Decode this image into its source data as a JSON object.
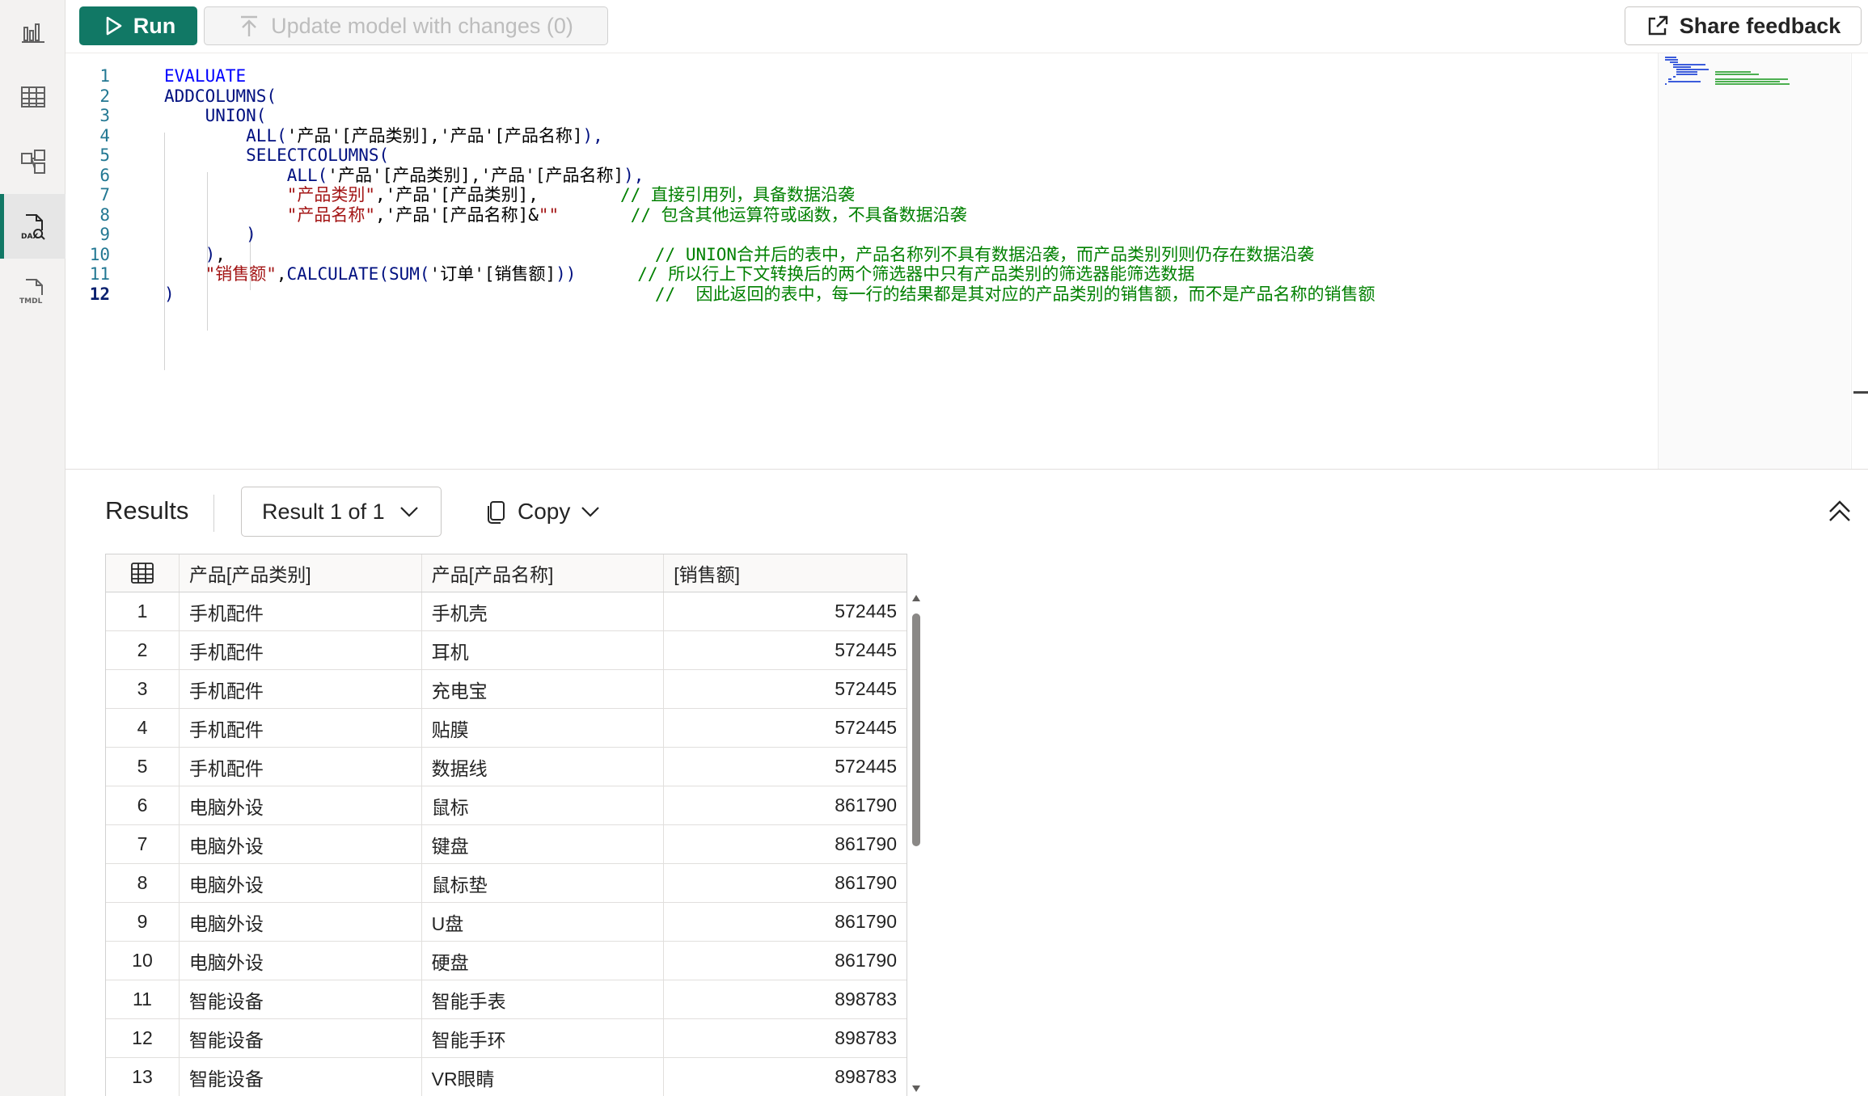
{
  "toolbar": {
    "run_label": "Run",
    "update_label": "Update model with changes (0)",
    "share_label": "Share feedback"
  },
  "sidebar": {
    "items": [
      {
        "icon": "report-icon"
      },
      {
        "icon": "table-icon"
      },
      {
        "icon": "model-icon"
      },
      {
        "icon": "dax-query-icon",
        "label": "DAX",
        "active": true
      },
      {
        "icon": "tmdl-icon",
        "label": "TMDL"
      }
    ]
  },
  "editor": {
    "lines": [
      {
        "n": "1",
        "tokens": [
          {
            "t": "kw",
            "v": "EVALUATE"
          }
        ]
      },
      {
        "n": "2",
        "tokens": [
          {
            "t": "fn",
            "v": "ADDCOLUMNS("
          }
        ]
      },
      {
        "n": "3",
        "tokens": [
          {
            "t": "pl",
            "v": "    "
          },
          {
            "t": "fn",
            "v": "UNION("
          }
        ]
      },
      {
        "n": "4",
        "tokens": [
          {
            "t": "pl",
            "v": "        "
          },
          {
            "t": "fn",
            "v": "ALL("
          },
          {
            "t": "pl",
            "v": "'产品'[产品类别],'产品'[产品名称]"
          },
          {
            "t": "fn",
            "v": "),"
          }
        ]
      },
      {
        "n": "5",
        "tokens": [
          {
            "t": "pl",
            "v": "        "
          },
          {
            "t": "fn",
            "v": "SELECTCOLUMNS("
          }
        ]
      },
      {
        "n": "6",
        "tokens": [
          {
            "t": "pl",
            "v": "            "
          },
          {
            "t": "fn",
            "v": "ALL("
          },
          {
            "t": "pl",
            "v": "'产品'[产品类别],'产品'[产品名称]"
          },
          {
            "t": "fn",
            "v": "),"
          }
        ]
      },
      {
        "n": "7",
        "tokens": [
          {
            "t": "pl",
            "v": "            "
          },
          {
            "t": "st",
            "v": "\"产品类别\""
          },
          {
            "t": "pl",
            "v": ",'产品'[产品类别],"
          },
          {
            "t": "pl",
            "v": "        "
          },
          {
            "t": "cm",
            "v": "// 直接引用列，具备数据沿袭"
          }
        ]
      },
      {
        "n": "8",
        "tokens": [
          {
            "t": "pl",
            "v": "            "
          },
          {
            "t": "st",
            "v": "\"产品名称\""
          },
          {
            "t": "pl",
            "v": ",'产品'[产品名称]&"
          },
          {
            "t": "st",
            "v": "\"\""
          },
          {
            "t": "pl",
            "v": "       "
          },
          {
            "t": "cm",
            "v": "// 包含其他运算符或函数，不具备数据沿袭"
          }
        ]
      },
      {
        "n": "9",
        "tokens": [
          {
            "t": "pl",
            "v": "        "
          },
          {
            "t": "fn",
            "v": ")"
          }
        ]
      },
      {
        "n": "10",
        "tokens": [
          {
            "t": "pl",
            "v": "    "
          },
          {
            "t": "fn",
            "v": ")"
          },
          {
            "t": "pl",
            "v": ","
          },
          {
            "t": "pl",
            "v": "                                          "
          },
          {
            "t": "cm",
            "v": "// UNION合并后的表中，产品名称列不具有数据沿袭，而产品类别列则仍存在数据沿袭"
          }
        ]
      },
      {
        "n": "11",
        "tokens": [
          {
            "t": "pl",
            "v": "    "
          },
          {
            "t": "st",
            "v": "\"销售额\""
          },
          {
            "t": "pl",
            "v": ","
          },
          {
            "t": "fn",
            "v": "CALCULATE(SUM("
          },
          {
            "t": "pl",
            "v": "'订单'[销售额]"
          },
          {
            "t": "fn",
            "v": "))"
          },
          {
            "t": "pl",
            "v": "      "
          },
          {
            "t": "cm",
            "v": "// 所以行上下文转换后的两个筛选器中只有产品类别的筛选器能筛选数据"
          }
        ]
      },
      {
        "n": "12",
        "tokens": [
          {
            "t": "fn",
            "v": ")"
          },
          {
            "t": "pl",
            "v": "                                               "
          },
          {
            "t": "cm",
            "v": "//  因此返回的表中，每一行的结果都是其对应的产品类别的销售额，而不是产品名称的销售额"
          }
        ]
      }
    ]
  },
  "results": {
    "title": "Results",
    "result_selector": "Result 1 of 1",
    "copy_label": "Copy",
    "columns": [
      "产品[产品类别]",
      "产品[产品名称]",
      "[销售额]"
    ],
    "rows": [
      [
        "1",
        "手机配件",
        "手机壳",
        "572445"
      ],
      [
        "2",
        "手机配件",
        "耳机",
        "572445"
      ],
      [
        "3",
        "手机配件",
        "充电宝",
        "572445"
      ],
      [
        "4",
        "手机配件",
        "贴膜",
        "572445"
      ],
      [
        "5",
        "手机配件",
        "数据线",
        "572445"
      ],
      [
        "6",
        "电脑外设",
        "鼠标",
        "861790"
      ],
      [
        "7",
        "电脑外设",
        "键盘",
        "861790"
      ],
      [
        "8",
        "电脑外设",
        "鼠标垫",
        "861790"
      ],
      [
        "9",
        "电脑外设",
        "U盘",
        "861790"
      ],
      [
        "10",
        "电脑外设",
        "硬盘",
        "861790"
      ],
      [
        "11",
        "智能设备",
        "智能手表",
        "898783"
      ],
      [
        "12",
        "智能设备",
        "智能手环",
        "898783"
      ],
      [
        "13",
        "智能设备",
        "VR眼睛",
        "898783"
      ]
    ]
  },
  "colors": {
    "accent": "#117865",
    "keyword": "#0000ff",
    "function": "#001080",
    "string": "#a31515",
    "comment": "#008000",
    "line_number": "#237893"
  }
}
